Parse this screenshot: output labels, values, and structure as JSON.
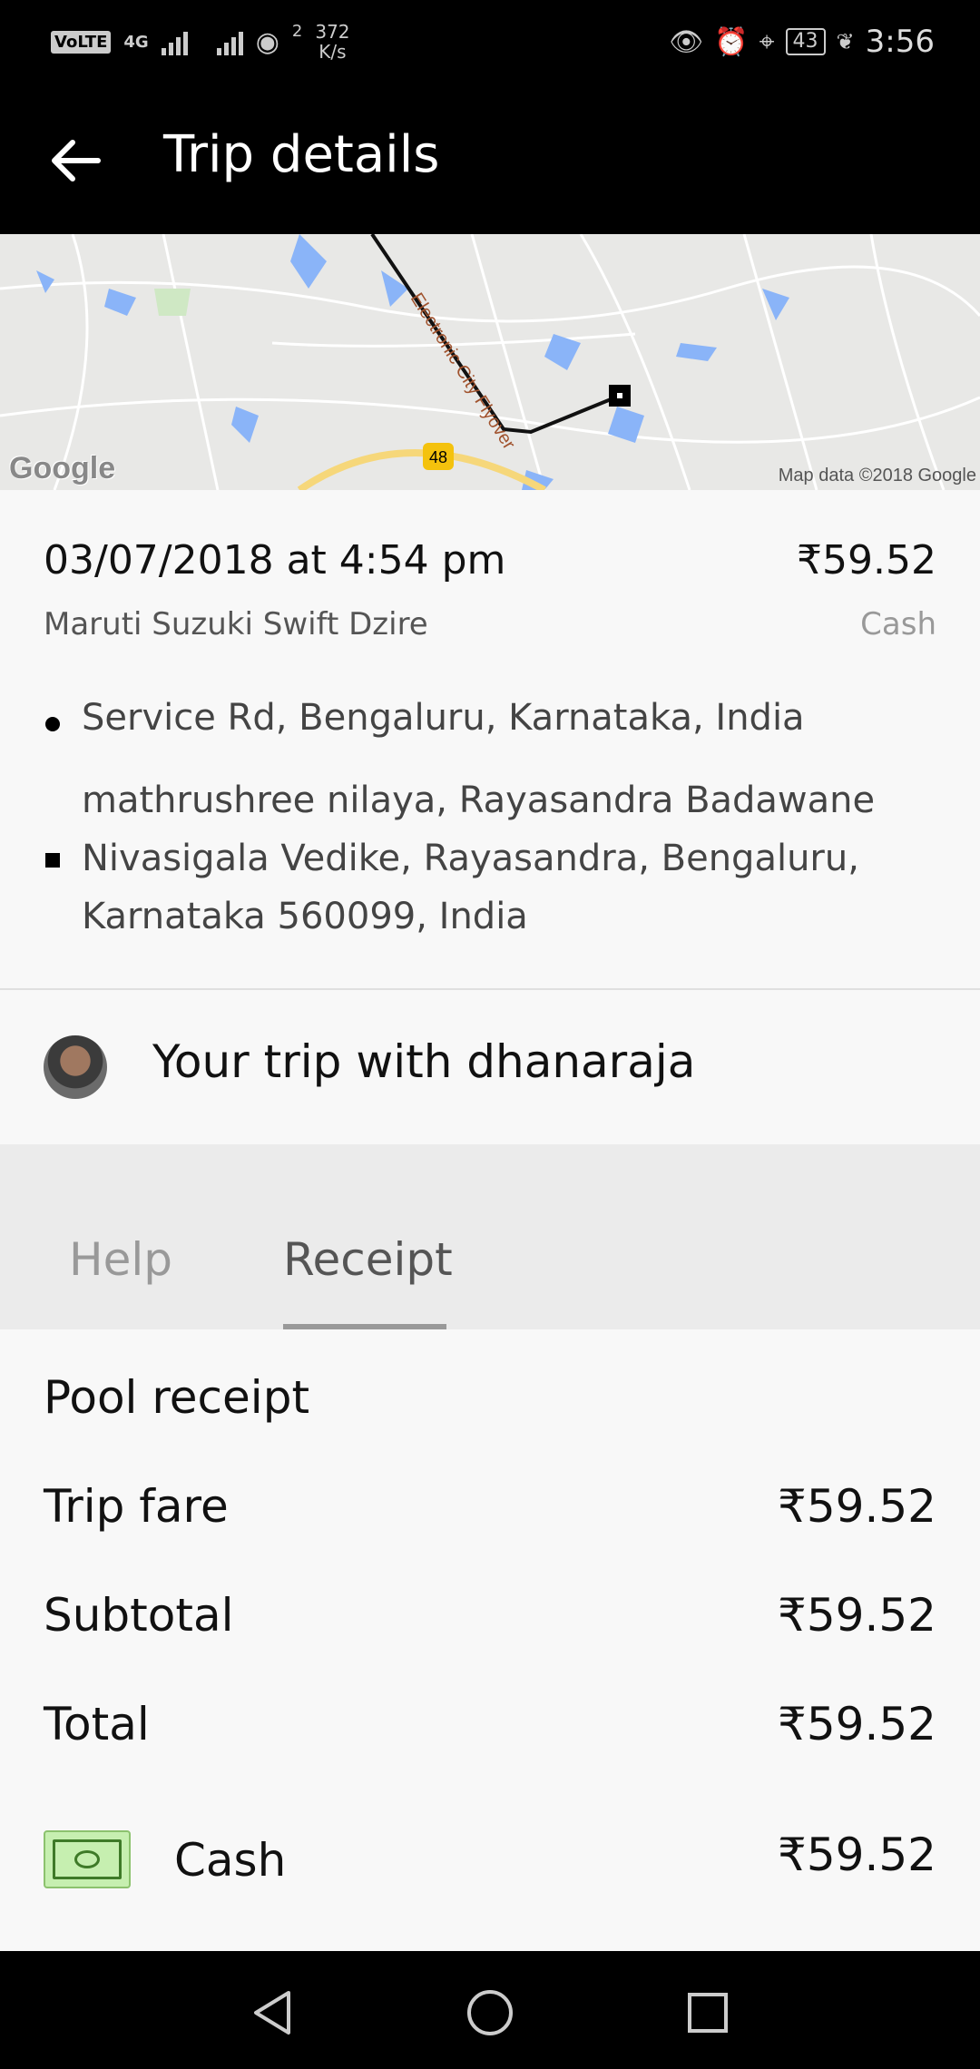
{
  "status_bar": {
    "volte": "VoLTE",
    "network": "4G",
    "speed_value": "372",
    "speed_unit": "K/s",
    "speed_count": "2",
    "battery": "43",
    "time": "3:56",
    "icons": [
      "eye-icon",
      "alarm-icon",
      "location-icon",
      "battery-icon",
      "leaf-icon"
    ]
  },
  "app_bar": {
    "title": "Trip details",
    "back_icon": "arrow-left-icon"
  },
  "map": {
    "logo": "Google",
    "attribution": "Map data ©2018 Google",
    "road_label": "Electronic City Flyover",
    "shield": "48"
  },
  "trip": {
    "datetime": "03/07/2018 at 4:54 pm",
    "price": "₹59.52",
    "car": "Maruti Suzuki Swift Dzire",
    "payment": "Cash",
    "pickup": "Service Rd, Bengaluru, Karnataka, India",
    "dropoff": "mathrushree nilaya, Rayasandra Badawane Nivasigala Vedike, Rayasandra, Bengaluru, Karnataka 560099, India"
  },
  "driver": {
    "text": "Your trip with dhanaraja"
  },
  "tabs": {
    "help": "Help",
    "receipt": "Receipt",
    "active": "Receipt"
  },
  "receipt": {
    "title": "Pool receipt",
    "rows": [
      {
        "label": "Trip fare",
        "value": "₹59.52"
      },
      {
        "label": "Subtotal",
        "value": "₹59.52"
      },
      {
        "label": "Total",
        "value": "₹59.52"
      }
    ],
    "payment_label": "Cash",
    "payment_value": "₹59.52",
    "payment_icon": "cash-icon"
  },
  "colors": {
    "bar_bg": "#000000",
    "map_water": "#8ab4f8",
    "route": "#111111",
    "cash_icon_bg": "#c6efb0"
  }
}
